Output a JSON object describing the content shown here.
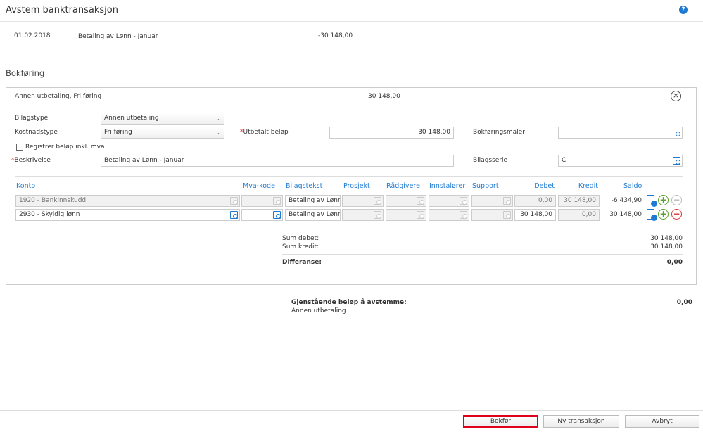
{
  "title": "Avstem banktransaksjon",
  "help": "?",
  "transaction": {
    "date": "01.02.2018",
    "text": "Betaling av Lønn - Januar",
    "amount": "-30 148,00"
  },
  "section_title": "Bokføring",
  "entry": {
    "summary": "Annen utbetaling, Fri føring",
    "amount": "30 148,00",
    "bilagstype_label": "Bilagstype",
    "bilagstype": "Annen utbetaling",
    "kostnadstype_label": "Kostnadstype",
    "kostnadstype": "Fri føring",
    "utbetalt_label": "Utbetalt beløp",
    "utbetalt": "30 148,00",
    "bokforingsmaler_label": "Bokføringsmaler",
    "bokforingsmaler": "",
    "checkbox_label": "Registrer beløp inkl. mva",
    "beskrivelse_label": "Beskrivelse",
    "beskrivelse": "Betaling av Lønn - Januar",
    "bilagsserie_label": "Bilagsserie",
    "bilagsserie": "C",
    "required": "*"
  },
  "table": {
    "headers": {
      "konto": "Konto",
      "mva": "Mva-kode",
      "bilagstekst": "Bilagstekst",
      "prosjekt": "Prosjekt",
      "radgivere": "Rådgivere",
      "innstalorer": "Innstalører",
      "support": "Support",
      "debet": "Debet",
      "kredit": "Kredit",
      "saldo": "Saldo"
    },
    "rows": [
      {
        "konto": "1920 - Bankinnskudd",
        "mva": "",
        "bilagstekst": "Betaling av Lønn -",
        "debet": "0,00",
        "kredit": "30 148,00",
        "saldo": "-6 434,90"
      },
      {
        "konto": "2930 - Skyldig lønn",
        "mva": "",
        "bilagstekst": "Betaling av Lønn -",
        "debet": "30 148,00",
        "kredit": "0,00",
        "saldo": "30 148,00"
      }
    ]
  },
  "sums": {
    "debet_label": "Sum debet:",
    "debet": "30 148,00",
    "kredit_label": "Sum kredit:",
    "kredit": "30 148,00",
    "diff_label": "Differanse:",
    "diff": "0,00"
  },
  "remaining": {
    "label": "Gjenstående beløp å avstemme:",
    "value": "0,00",
    "sub": "Annen utbetaling"
  },
  "buttons": {
    "bokfor": "Bokfør",
    "ny": "Ny transaksjon",
    "avbryt": "Avbryt"
  },
  "colors": {
    "accent": "#1f7ad1",
    "highlight": "#e0001b"
  }
}
